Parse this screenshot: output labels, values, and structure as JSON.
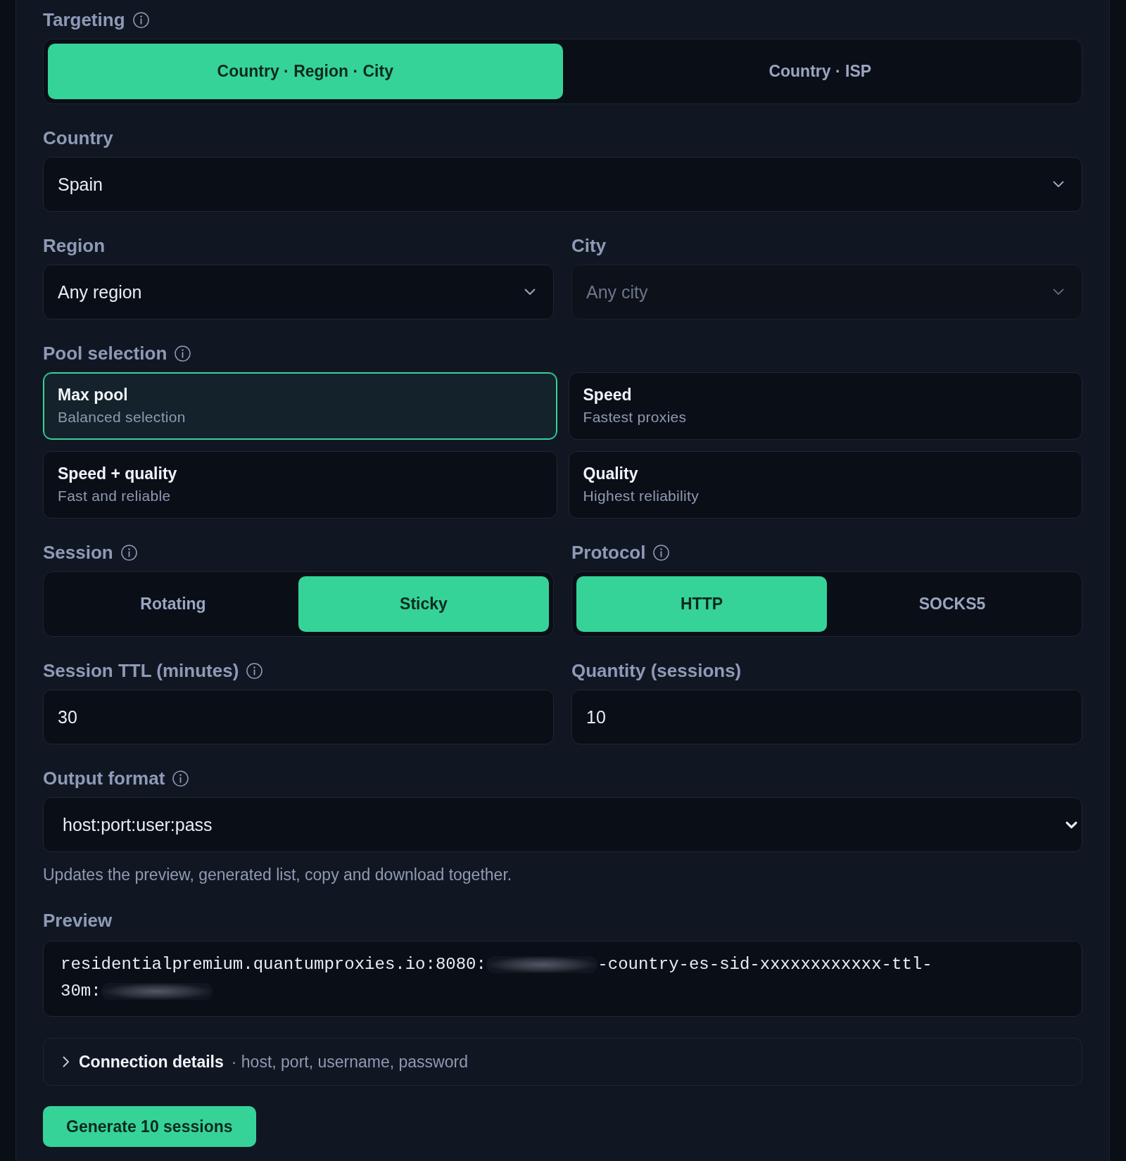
{
  "targeting": {
    "label": "Targeting",
    "has_info": true,
    "options": [
      {
        "label": "Country · Region · City",
        "selected": true
      },
      {
        "label": "Country · ISP",
        "selected": false
      }
    ]
  },
  "country": {
    "label": "Country",
    "value": "Spain",
    "disabled": false
  },
  "region": {
    "label": "Region",
    "value": "Any region",
    "disabled": false
  },
  "city": {
    "label": "City",
    "value": "Any city",
    "disabled": true
  },
  "pool": {
    "label": "Pool selection",
    "has_info": true,
    "options": [
      {
        "title": "Max pool",
        "subtitle": "Balanced selection",
        "selected": true
      },
      {
        "title": "Speed",
        "subtitle": "Fastest proxies",
        "selected": false
      },
      {
        "title": "Speed + quality",
        "subtitle": "Fast and reliable",
        "selected": false
      },
      {
        "title": "Quality",
        "subtitle": "Highest reliability",
        "selected": false
      }
    ]
  },
  "session": {
    "label": "Session",
    "has_info": true,
    "options": [
      {
        "label": "Rotating",
        "selected": false
      },
      {
        "label": "Sticky",
        "selected": true
      }
    ]
  },
  "protocol": {
    "label": "Protocol",
    "has_info": true,
    "options": [
      {
        "label": "HTTP",
        "selected": true
      },
      {
        "label": "SOCKS5",
        "selected": false
      }
    ]
  },
  "session_ttl": {
    "label": "Session TTL (minutes)",
    "has_info": true,
    "value": "30"
  },
  "quantity": {
    "label": "Quantity (sessions)",
    "value": "10"
  },
  "output_format": {
    "label": "Output format",
    "has_info": true,
    "value": "host:port:user:pass",
    "help": "Updates the preview, generated list, copy and download together."
  },
  "preview": {
    "label": "Preview",
    "lines": [
      [
        {
          "kind": "text",
          "text": "residentialpremium.quantumproxies.io:8080:"
        },
        {
          "kind": "redacted"
        },
        {
          "kind": "text",
          "text": "-country-es-sid-xxxxxxxxxxxx-ttl-"
        }
      ],
      [
        {
          "kind": "text",
          "text": "30m:"
        },
        {
          "kind": "redacted"
        }
      ]
    ]
  },
  "connection_details": {
    "title": "Connection details",
    "summary": "· host, port, username, password",
    "expanded": false
  },
  "generate_button": {
    "label": "Generate 10 sessions"
  }
}
